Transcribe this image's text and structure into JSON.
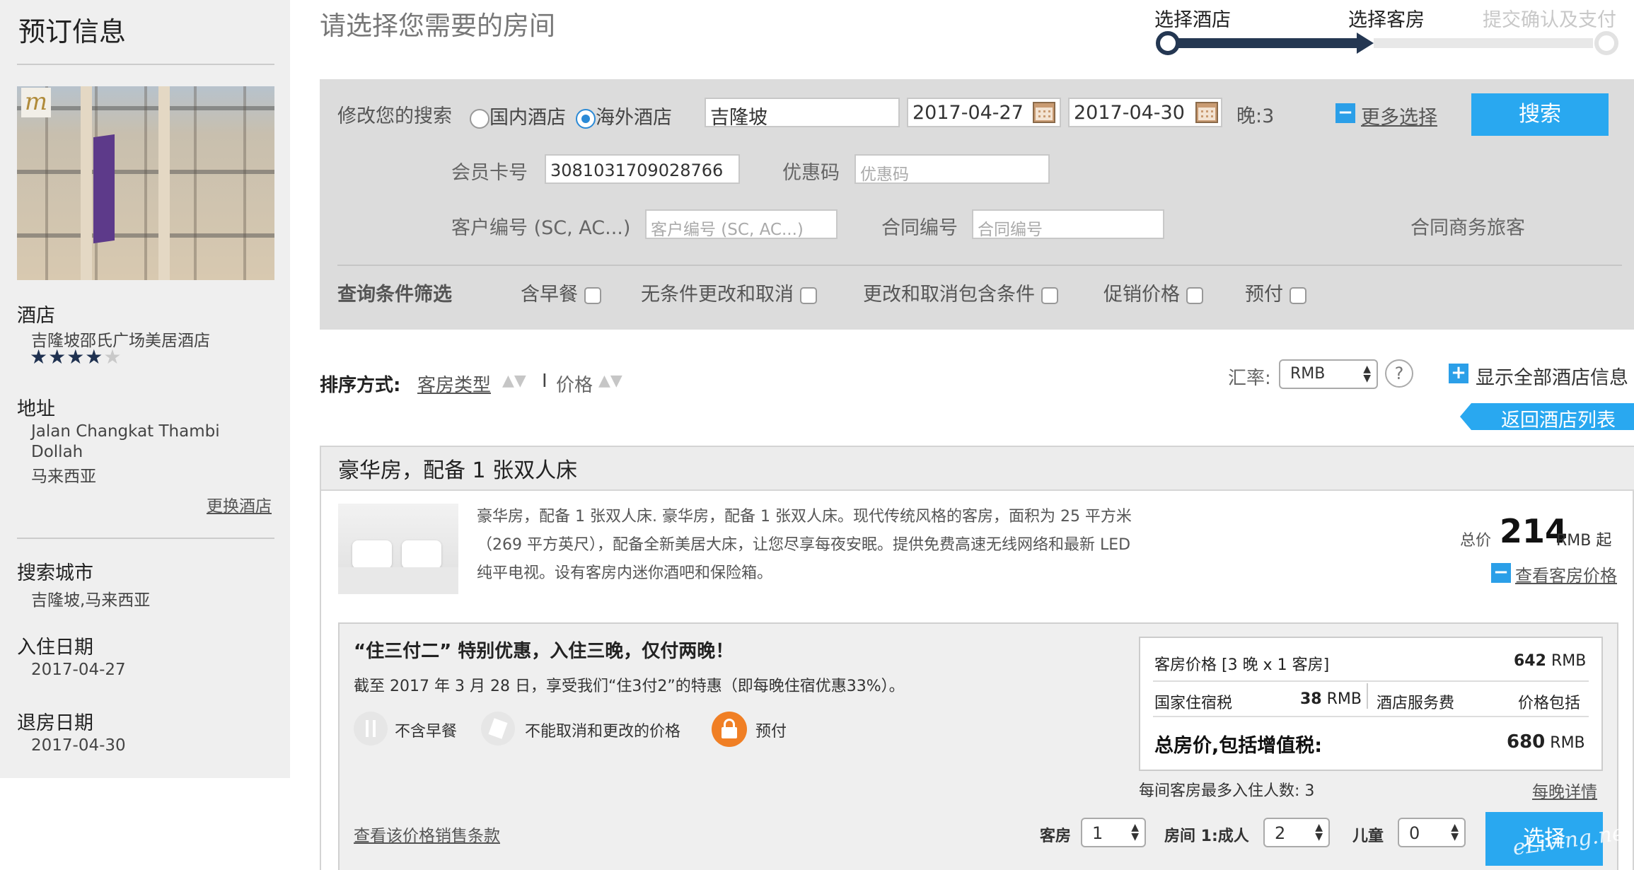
{
  "sidebar": {
    "title": "预订信息",
    "hotel_label": "酒店",
    "hotel_name": "吉隆坡邵氏广场美居酒店",
    "stars_filled": "★★★★",
    "stars_empty": "★",
    "address_label": "地址",
    "address_line1": "Jalan Changkat Thambi",
    "address_line2": "Dollah",
    "address_line3": "马来西亚",
    "change_hotel": "更换酒店",
    "city_label": "搜索城市",
    "city_value": "吉隆坡,马来西亚",
    "checkin_label": "入住日期",
    "checkin_value": "2017-04-27",
    "checkout_label": "退房日期",
    "checkout_value": "2017-04-30",
    "photo_logo": "m"
  },
  "header": {
    "page_title": "请选择您需要的房间",
    "steps": [
      "选择酒店",
      "选择客房",
      "提交确认及支付"
    ]
  },
  "search": {
    "modify_label": "修改您的搜索",
    "domestic": "国内酒店",
    "overseas": "海外酒店",
    "city": "吉隆坡",
    "date_in": "2017-04-27",
    "date_out": "2017-04-30",
    "nights": "晚:3",
    "more": "更多选择",
    "search_btn": "搜索",
    "card_label": "会员卡号",
    "card_value": "3081031709028766",
    "promo_label": "优惠码",
    "promo_ph": "优惠码",
    "client_label": "客户编号 (SC, AC...)",
    "client_ph": "客户编号 (SC, AC...)",
    "contract_label": "合同编号",
    "contract_ph": "合同编号",
    "biz_label": "合同商务旅客",
    "filter_label": "查询条件筛选",
    "filters": [
      "含早餐",
      "无条件更改和取消",
      "更改和取消包含条件",
      "促销价格",
      "预付"
    ]
  },
  "sort": {
    "label": "排序方式:",
    "by_type": "客房类型",
    "sep": "I",
    "by_price": "价格",
    "rate_label": "汇率:",
    "currency": "RMB",
    "help": "?",
    "show_all": "显示全部酒店信息",
    "back": "返回酒店列表"
  },
  "room": {
    "title": "豪华房，配备 1 张双人床",
    "desc1": "豪华房，配备 1 张双人床. 豪华房，配备 1 张双人床。现代传统风格的客房，面积为 25 平方米",
    "desc2": "（269 平方英尺），配备全新美居大床，让您尽享每夜安眠。提供免费高速无线网络和最新 LED",
    "desc3": "纯平电视。设有客房内迷你酒吧和保险箱。",
    "total_label": "总价",
    "total_price": "214",
    "total_unit": "RMB 起",
    "view_prices": "查看客房价格"
  },
  "offer": {
    "title": "“住三付二” 特别优惠，入住三晚，仅付两晚！",
    "sub": "截至 2017 年 3 月 28 日，享受我们“住3付2”的特惠（即每晚住宿优惠33%）。",
    "tag1": "不含早餐",
    "tag2": "不能取消和更改的价格",
    "tag3": "预付",
    "terms": "查看该价格销售条款",
    "price_label": "客房价格 [3 晚 x 1 客房]",
    "price_val": "642",
    "tax_label": "国家住宿税",
    "tax_val": "38",
    "service_label": "酒店服务费",
    "service_val": "价格包括",
    "grand_label": "总房价,包括增值税:",
    "grand_val": "680",
    "currency": "RMB",
    "max_guests": "每间客房最多入住人数: 3",
    "nightly": "每晚详情",
    "rooms_label": "客房",
    "rooms_val": "1",
    "adults_label": "房间 1:成人",
    "adults_val": "2",
    "children_label": "儿童",
    "children_val": "0",
    "select_btn": "选择",
    "watermark": "eLiving.net"
  }
}
